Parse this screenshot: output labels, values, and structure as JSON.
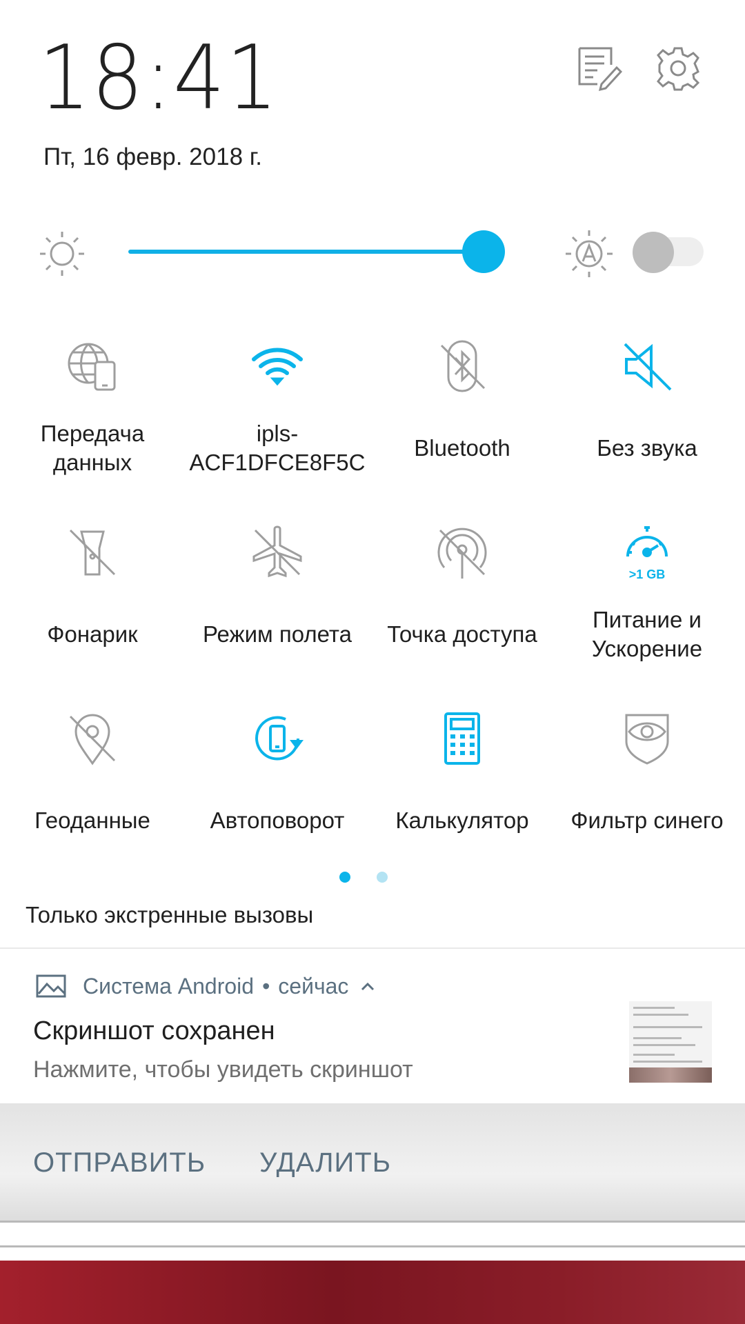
{
  "header": {
    "time": "18:41",
    "date": "Пт, 16 февр. 2018 г.",
    "edit_icon": "edit-list-icon",
    "settings_icon": "gear-icon"
  },
  "brightness": {
    "level": 1.0,
    "auto_enabled": false
  },
  "tiles": [
    {
      "label": "Передача\nданных",
      "icon": "mobile-data-icon",
      "active": false
    },
    {
      "label": "ipls-\nACF1DFCE8F5C",
      "icon": "wifi-icon",
      "active": true
    },
    {
      "label": "Bluetooth",
      "icon": "bluetooth-off-icon",
      "active": false
    },
    {
      "label": "Без звука",
      "icon": "mute-icon",
      "active": true
    },
    {
      "label": "Фонарик",
      "icon": "flashlight-off-icon",
      "active": false
    },
    {
      "label": "Режим полета",
      "icon": "airplane-off-icon",
      "active": false
    },
    {
      "label": "Точка доступа",
      "icon": "hotspot-off-icon",
      "active": false
    },
    {
      "label": "Питание и\nУскорение",
      "icon": "speedometer-icon",
      "active": true,
      "sub": ">1 GB"
    },
    {
      "label": "Геоданные",
      "icon": "location-off-icon",
      "active": false
    },
    {
      "label": "Автоповорот",
      "icon": "auto-rotate-icon",
      "active": true
    },
    {
      "label": "Калькулятор",
      "icon": "calculator-icon",
      "active": true
    },
    {
      "label": "Фильтр синего",
      "icon": "eye-shield-icon",
      "active": false
    }
  ],
  "pages": {
    "count": 2,
    "current": 0
  },
  "emergency_text": "Только экстренные вызовы",
  "notification": {
    "app": "Система Android",
    "separator": "•",
    "time": "сейчас",
    "title": "Скриншот сохранен",
    "body": "Нажмите, чтобы увидеть скриншот",
    "actions": [
      "ОТПРАВИТЬ",
      "УДАЛИТЬ"
    ]
  },
  "colors": {
    "accent": "#0bb4ea",
    "inactive_icon": "#9e9e9e",
    "notification_text": "#5b7080"
  }
}
